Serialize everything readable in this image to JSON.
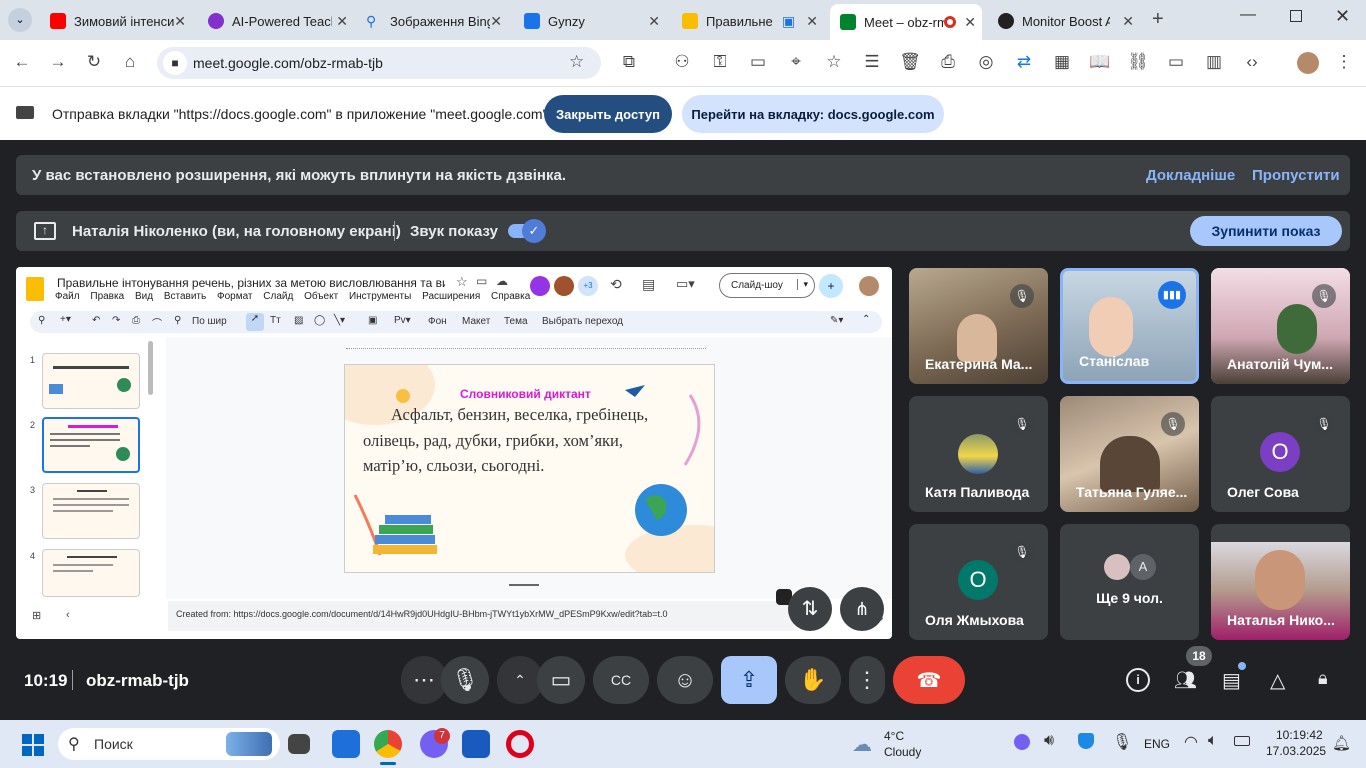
{
  "browser": {
    "tabs": [
      {
        "title": "Зимовий інтенсив",
        "color": "#ff0000"
      },
      {
        "title": "AI-Powered Teach",
        "color": "#8430ce"
      },
      {
        "title": "Зображення Bing",
        "color": "#1a73e8"
      },
      {
        "title": "Gynzy",
        "color": "#1a73e8"
      },
      {
        "title": "Правильне інт",
        "color": "#fbbc04"
      },
      {
        "title": "Meet – obz-rmab-tjb",
        "color": "#00832d"
      },
      {
        "title": "Monitor Boost Al",
        "color": "#222222"
      }
    ],
    "url": "meet.google.com/obz-rmab-tjb"
  },
  "share_notice": {
    "text": "Отправка вкладки \"https://docs.google.com\" в приложение \"meet.google.com\"...",
    "stop_label": "Закрыть доступ",
    "switch_label": "Перейти на вкладку: docs.google.com"
  },
  "meet": {
    "ext_warning": "У вас встановлено розширення, які можуть вплинути на якість дзвінка.",
    "learn_more": "Докладніше",
    "skip": "Пропустити",
    "presenting": "Наталія Ніколенко (ви, на головному екрані)",
    "share_audio": "Звук показу",
    "stop_presenting": "Зупинити показ",
    "time": "10:19",
    "meeting_code": "obz-rmab-tjb",
    "participants_count": "18",
    "participants": [
      {
        "name": "Екатерина Ма..."
      },
      {
        "name": "Станіслав"
      },
      {
        "name": "Анатолій Чум..."
      },
      {
        "name": "Катя Паливода"
      },
      {
        "name": "Татьяна Гуляе..."
      },
      {
        "name": "Олег Сова",
        "initial": "О",
        "color": "#7b3fc4"
      },
      {
        "name": "Оля Жмыхова",
        "initial": "О",
        "color": "#00796b"
      },
      {
        "name": "Ще 9 чол.",
        "initial": "А"
      },
      {
        "name": "Наталья Нико..."
      }
    ]
  },
  "slides": {
    "doc_title": "Правильне інтонування речень, різних за метою висловлювання та ви...",
    "menu": [
      "Файл",
      "Правка",
      "Вид",
      "Вставить",
      "Формат",
      "Слайд",
      "Объект",
      "Инструменты",
      "Расширения",
      "Справка"
    ],
    "slideshow_label": "Слайд-шоу",
    "collab_extra": "+3",
    "toolbar": {
      "zoom": "По шир",
      "bg": "Фон",
      "layout": "Макет",
      "theme": "Тема",
      "transition": "Выбрать переход"
    },
    "slide_numbers": [
      "1",
      "2",
      "3",
      "4"
    ],
    "current_slide": {
      "title": "Словниковий диктант",
      "line1": "Асфальт, бензин, веселка, гребінець,",
      "line2": "олівець, рад, дубки, грибки, хом’яки,",
      "line3": "матір’ю, сльози, сьогодні."
    },
    "notes": "Created from: https://docs.google.com/document/d/14HwR9jd0UHdgIU-BHbm-jTWYt1ybXrMW_dPESmP9Kxw/edit?tab=t.0"
  },
  "taskbar": {
    "search_label": "Поиск",
    "weather_temp": "4°C",
    "weather_desc": "Cloudy",
    "language": "ENG",
    "clock_time": "10:19:42",
    "clock_date": "17.03.2025",
    "viber_badge": "7"
  }
}
